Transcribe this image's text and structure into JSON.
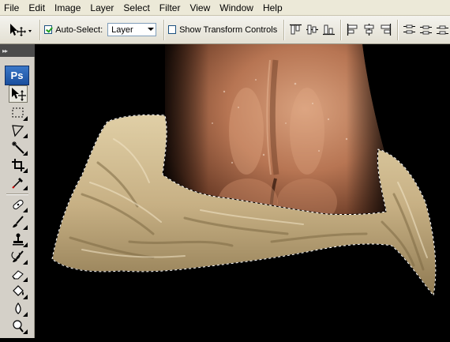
{
  "menu": [
    "File",
    "Edit",
    "Image",
    "Layer",
    "Select",
    "Filter",
    "View",
    "Window",
    "Help"
  ],
  "options": {
    "auto_select_label": "Auto-Select:",
    "auto_select_checked": true,
    "auto_select_value": "Layer",
    "transform_label": "Show Transform Controls",
    "transform_checked": false
  },
  "toolbox": {
    "logo": "Ps",
    "tools": [
      "move-icon",
      "marquee-icon",
      "lasso-icon",
      "magic-wand-icon",
      "crop-icon",
      "eyedropper-icon",
      "healing-brush-icon",
      "brush-icon",
      "clone-stamp-icon",
      "history-brush-icon",
      "eraser-icon",
      "paint-bucket-icon",
      "blur-icon",
      "dodge-icon"
    ],
    "active_tool": "move-icon"
  },
  "canvas": {
    "background": "#000000",
    "selection": "marching-ants"
  }
}
